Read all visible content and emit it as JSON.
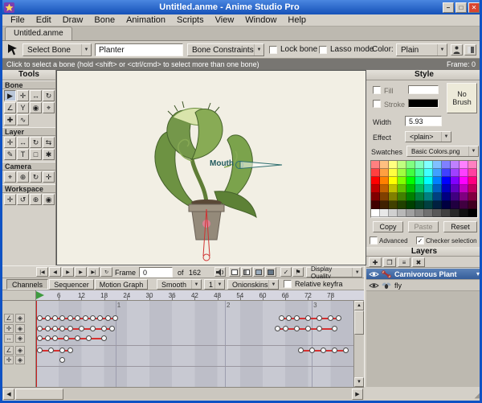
{
  "window": {
    "title": "Untitled.anme - Anime Studio Pro"
  },
  "titlebar": {
    "minimize_glyph": "–",
    "maximize_glyph": "□",
    "close_glyph": "✕"
  },
  "menu": {
    "items": [
      "File",
      "Edit",
      "Draw",
      "Bone",
      "Animation",
      "Scripts",
      "View",
      "Window",
      "Help"
    ]
  },
  "document_tab": {
    "label": "Untitled.anme"
  },
  "toolbar": {
    "select_bone_label": "Select Bone",
    "bone_name_value": "Planter",
    "bone_constraints_label": "Bone Constraints",
    "lock_bone_label": "Lock bone",
    "lock_bone_checked": false,
    "lasso_mode_label": "Lasso mode",
    "lasso_mode_checked": false,
    "color_label": "Color:",
    "color_value": "Plain"
  },
  "hint_bar": {
    "text": "Click to select a bone (hold <shift> or <ctrl/cmd> to select more than one bone)",
    "frame_label": "Frame: 0"
  },
  "tools_panel": {
    "title": "Tools",
    "sections": [
      {
        "label": "Bone",
        "tools": [
          {
            "name": "select-bone",
            "glyph": "▶",
            "active": true
          },
          {
            "name": "translate-bone",
            "glyph": "✛"
          },
          {
            "name": "scale-bone",
            "glyph": "↔"
          },
          {
            "name": "rotate-bone",
            "glyph": "↻"
          },
          {
            "name": "add-bone",
            "glyph": "∠"
          },
          {
            "name": "reparent-bone",
            "glyph": "Y"
          },
          {
            "name": "bone-strength",
            "glyph": "◉"
          },
          {
            "name": "offset-bone",
            "glyph": "⌖"
          },
          {
            "name": "manipulate-bones",
            "glyph": "✚"
          },
          {
            "name": "bone-dynamics",
            "glyph": "∿"
          }
        ]
      },
      {
        "label": "Layer",
        "tools": [
          {
            "name": "translate-layer",
            "glyph": "✛"
          },
          {
            "name": "scale-layer",
            "glyph": "↔"
          },
          {
            "name": "rotate-layer",
            "glyph": "↻"
          },
          {
            "name": "flip-layer",
            "glyph": "⇆"
          },
          {
            "name": "draw-shape",
            "glyph": "✎"
          },
          {
            "name": "insert-text",
            "glyph": "T"
          },
          {
            "name": "rectangle",
            "glyph": "□"
          },
          {
            "name": "particles",
            "glyph": "✱"
          }
        ]
      },
      {
        "label": "Camera",
        "tools": [
          {
            "name": "track-camera",
            "glyph": "⌖"
          },
          {
            "name": "zoom-camera",
            "glyph": "⊕"
          },
          {
            "name": "roll-camera",
            "glyph": "↻"
          },
          {
            "name": "pan-tilt-camera",
            "glyph": "✛"
          }
        ]
      },
      {
        "label": "Workspace",
        "tools": [
          {
            "name": "pan-workspace",
            "glyph": "✛"
          },
          {
            "name": "rotate-workspace",
            "glyph": "↺"
          },
          {
            "name": "zoom-workspace",
            "glyph": "⊕"
          },
          {
            "name": "reset-workspace",
            "glyph": "◉"
          }
        ]
      }
    ]
  },
  "canvas": {
    "bone_label": "Mouth"
  },
  "style_panel": {
    "title": "Style",
    "fill_label": "Fill",
    "fill_checked": false,
    "fill_color": "#ffffff",
    "stroke_label": "Stroke",
    "stroke_checked": false,
    "stroke_color": "#000000",
    "no_brush_label": "No Brush",
    "width_label": "Width",
    "width_value": "5.93",
    "effect_label": "Effect",
    "effect_value": "<plain>",
    "swatches_label": "Swatches",
    "swatches_value": "Basic Colors.png",
    "copy_label": "Copy",
    "paste_label": "Paste",
    "reset_label": "Reset",
    "advanced_label": "Advanced",
    "advanced_checked": false,
    "checker_label": "Checker selection",
    "checker_checked": true,
    "palette_rows": [
      [
        "#ff8080",
        "#ffc080",
        "#ffff80",
        "#c0ff80",
        "#80ff80",
        "#80ffc0",
        "#80ffff",
        "#80c0ff",
        "#8080ff",
        "#c080ff",
        "#ff80ff",
        "#ff80c0"
      ],
      [
        "#ff4040",
        "#ffa040",
        "#ffff40",
        "#a0ff40",
        "#40ff40",
        "#40ffa0",
        "#40ffff",
        "#40a0ff",
        "#4040ff",
        "#a040ff",
        "#ff40ff",
        "#ff40a0"
      ],
      [
        "#ff0000",
        "#ff8000",
        "#ffff00",
        "#80ff00",
        "#00ff00",
        "#00ff80",
        "#00ffff",
        "#0080ff",
        "#0000ff",
        "#8000ff",
        "#ff00ff",
        "#ff0080"
      ],
      [
        "#c00000",
        "#c06000",
        "#c0c000",
        "#60c000",
        "#00c000",
        "#00c060",
        "#00c0c0",
        "#0060c0",
        "#0000c0",
        "#6000c0",
        "#c000c0",
        "#c00060"
      ],
      [
        "#800000",
        "#804000",
        "#808000",
        "#408000",
        "#008000",
        "#008040",
        "#008080",
        "#004080",
        "#000080",
        "#400080",
        "#800080",
        "#800040"
      ],
      [
        "#400000",
        "#402000",
        "#404000",
        "#204000",
        "#004000",
        "#004020",
        "#004040",
        "#002040",
        "#000040",
        "#200040",
        "#400040",
        "#400020"
      ],
      [
        "#ffffff",
        "#e8e8e8",
        "#d0d0d0",
        "#b8b8b8",
        "#a0a0a0",
        "#888888",
        "#707070",
        "#585858",
        "#404040",
        "#282828",
        "#101010",
        "#000000"
      ]
    ]
  },
  "layers_panel": {
    "title": "Layers",
    "buttons": [
      {
        "name": "new-layer-button",
        "glyph": "✚"
      },
      {
        "name": "new-group-button",
        "glyph": "❐"
      },
      {
        "name": "duplicate-layer-button",
        "glyph": "≡"
      },
      {
        "name": "delete-layer-button",
        "glyph": "✖"
      }
    ],
    "layers": [
      {
        "name": "Carnivorous Plant",
        "type": "bone",
        "selected": true,
        "visible": true
      },
      {
        "name": "fly",
        "type": "image",
        "selected": false,
        "visible": true
      }
    ]
  },
  "playback": {
    "transport": [
      {
        "name": "go-start-button",
        "glyph": "|◀"
      },
      {
        "name": "step-back-button",
        "glyph": "◀"
      },
      {
        "name": "play-button",
        "glyph": "▶"
      },
      {
        "name": "step-forward-button",
        "glyph": "▶"
      },
      {
        "name": "go-end-button",
        "glyph": "▶|"
      },
      {
        "name": "loop-button",
        "glyph": "↻"
      }
    ],
    "frame_label": "Frame",
    "frame_value": "0",
    "of_label": "of",
    "total_frames": "162",
    "display_quality_label": "Display Quality"
  },
  "timeline": {
    "tabs": [
      "Channels",
      "Sequencer",
      "Motion Graph"
    ],
    "active_tab": "Channels",
    "smooth_label": "Smooth",
    "step_value": "1",
    "onionskins_label": "Onionskins",
    "relative_keyframes_label": "Relative keyfra",
    "relative_keyframes_checked": false,
    "playhead_frame": 0,
    "ruler_ticks": [
      6,
      12,
      18,
      24,
      30,
      36,
      42,
      48,
      54,
      60,
      66,
      72,
      78
    ],
    "markers": [
      {
        "label": "1",
        "frame": 21
      },
      {
        "label": "2",
        "frame": 50
      },
      {
        "label": "3",
        "frame": 73
      }
    ],
    "separators": [
      55,
      81
    ],
    "tracks": [
      {
        "channel_icons": [
          "∠",
          "◈"
        ],
        "y": 22,
        "segments": [
          [
            0,
            21
          ],
          [
            65,
            80
          ]
        ],
        "keys": [
          1,
          3,
          5,
          7,
          9,
          11,
          13,
          15,
          17,
          19,
          21,
          65,
          67,
          69,
          72,
          75,
          78,
          80
        ]
      },
      {
        "channel_icons": [
          "✛",
          "◈"
        ],
        "y": 35,
        "segments": [
          [
            0,
            20
          ],
          [
            64,
            79
          ]
        ],
        "keys": [
          1,
          3,
          5,
          7,
          9,
          12,
          15,
          18,
          20,
          64,
          66,
          69,
          72,
          75,
          79
        ]
      },
      {
        "channel_icons": [
          "↔",
          "◈"
        ],
        "y": 47,
        "segments": [
          [
            0,
            18
          ]
        ],
        "keys": [
          1,
          3,
          5,
          8,
          11,
          14,
          18
        ]
      },
      {
        "channel_icons": [
          "∠",
          "◈"
        ],
        "y": 62,
        "segments": [
          [
            0,
            9
          ],
          [
            70,
            82
          ]
        ],
        "keys": [
          1,
          4,
          7,
          9,
          70,
          73,
          76,
          79,
          82
        ]
      },
      {
        "channel_icons": [
          "✛",
          "◈"
        ],
        "y": 74,
        "segments": [],
        "keys": [
          7
        ]
      }
    ]
  }
}
